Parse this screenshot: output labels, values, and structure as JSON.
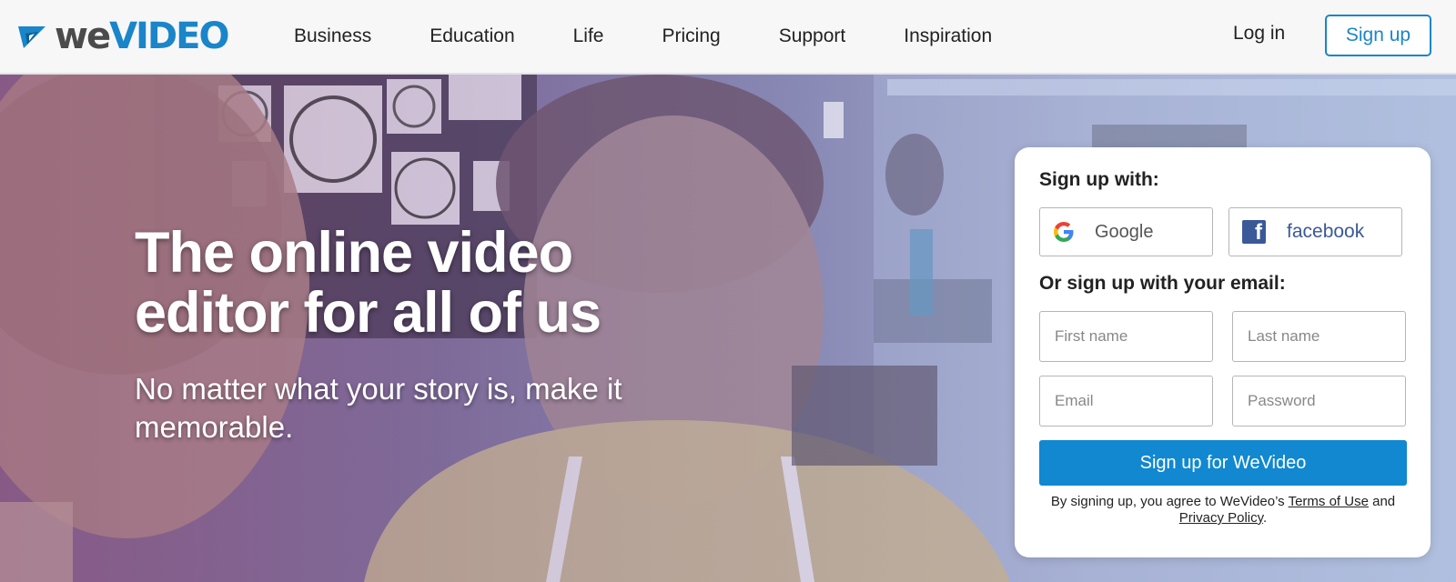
{
  "brand": {
    "we": "we",
    "video": "VIDEO",
    "accent": "#1a85c9"
  },
  "nav": {
    "items": [
      {
        "label": "Business"
      },
      {
        "label": "Education"
      },
      {
        "label": "Life"
      },
      {
        "label": "Pricing"
      },
      {
        "label": "Support"
      },
      {
        "label": "Inspiration"
      }
    ],
    "login": "Log in",
    "signup": "Sign up"
  },
  "hero": {
    "headline": "The online video editor for all of us",
    "subhead": "No matter what your story is, make it memorable."
  },
  "signup_card": {
    "title": "Sign up with:",
    "google_label": "Google",
    "facebook_label": "facebook",
    "email_title": "Or sign up with your email:",
    "first_name_placeholder": "First name",
    "last_name_placeholder": "Last name",
    "email_placeholder": "Email",
    "password_placeholder": "Password",
    "submit_label": "Sign up for WeVideo",
    "terms_prefix": "By signing up, you agree to WeVideo’s ",
    "terms_link": "Terms of Use",
    "terms_and": " and",
    "privacy_link": "Privacy Policy",
    "terms_suffix": "."
  },
  "icons": {
    "logo": "wevideo-logo-icon",
    "google": "google-icon",
    "facebook": "facebook-icon"
  }
}
